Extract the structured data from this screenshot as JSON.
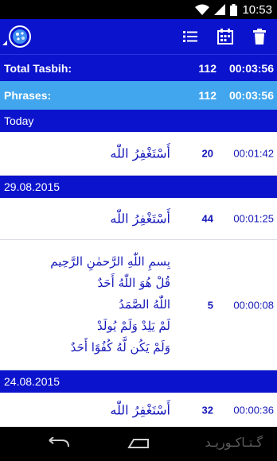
{
  "status_bar": {
    "time": "10:53"
  },
  "app_bar": {
    "actions": [
      "list-icon",
      "calendar-icon",
      "trash-icon"
    ]
  },
  "summary": {
    "total_label": "Total Tasbih:",
    "total_count": "112",
    "total_time": "00:03:56",
    "phrases_label": "Phrases:",
    "phrases_count": "112",
    "phrases_time": "00:03:56"
  },
  "sections": [
    {
      "date": "Today",
      "entries": [
        {
          "phrase": "أَسْتَغْفِرُ اللّٰه",
          "count": "20",
          "time": "00:01:42"
        }
      ]
    },
    {
      "date": "29.08.2015",
      "entries": [
        {
          "phrase": "أَسْتَغْفِرُ اللّٰه",
          "count": "44",
          "time": "00:01:25"
        },
        {
          "phrase_lines": [
            "بِسمِ اللّٰهِ الرَّحمٰنِ الرَّحِيم",
            "قُلْ هُوَ اللّٰهُ أَحَدٌ",
            "اللّٰهُ الصَّمَدُ",
            "لَمْ يَلِدْ وَلَمْ يُولَدْ",
            "وَلَمْ يَكُن لَّهُ كُفُوًا أَحَدٌ"
          ],
          "count": "5",
          "time": "00:00:08"
        }
      ]
    },
    {
      "date": "24.08.2015",
      "entries": [
        {
          "phrase": "أَسْتَغْفِرُ اللّٰه",
          "count": "32",
          "time": "00:00:36"
        }
      ]
    }
  ],
  "watermark": "گـتـاکـوریـد",
  "colors": {
    "primary": "#0b13cc",
    "accent": "#42a6ee",
    "text_blue": "#1518b8"
  }
}
